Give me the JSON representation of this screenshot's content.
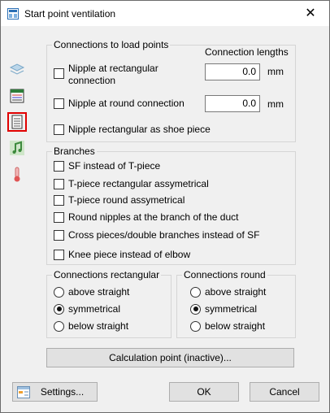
{
  "window": {
    "title": "Start point ventilation",
    "close": "✕"
  },
  "sidebar": {
    "icons": [
      "layers-icon",
      "table-icon",
      "document-icon",
      "music-note-icon",
      "thermometer-icon"
    ],
    "selected_index": 2
  },
  "load_points": {
    "group_label": "Connections to load points",
    "lengths_label": "Connection lengths",
    "nipple_rect_label": "Nipple at rectangular connection",
    "nipple_rect_value": "0.0",
    "nipple_round_label": "Nipple at round connection",
    "nipple_round_value": "0.0",
    "unit": "mm",
    "shoe_label": "Nipple rectangular as shoe piece"
  },
  "branches": {
    "group_label": "Branches",
    "items": [
      "SF instead of T-piece",
      "T-piece rectangular assymetrical",
      "T-piece round assymetrical",
      "Round nipples at the branch of the duct",
      "Cross pieces/double branches instead of SF",
      "Knee piece instead of elbow"
    ]
  },
  "conn_rect": {
    "group_label": "Connections rectangular",
    "options": [
      "above straight",
      "symmetrical",
      "below straight"
    ],
    "selected": 1
  },
  "conn_round": {
    "group_label": "Connections round",
    "options": [
      "above straight",
      "symmetrical",
      "below straight"
    ],
    "selected": 1
  },
  "calc_button": "Calculation point (inactive)...",
  "footer": {
    "settings": "Settings...",
    "ok": "OK",
    "cancel": "Cancel"
  }
}
